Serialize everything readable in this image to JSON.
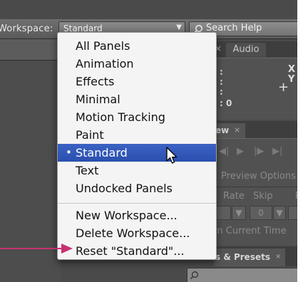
{
  "topbar": {
    "workspace_label": "Workspace:",
    "workspace_value": "Standard",
    "search_placeholder": "Search Help"
  },
  "menu": {
    "items": [
      {
        "label": "All Panels"
      },
      {
        "label": "Animation"
      },
      {
        "label": "Effects"
      },
      {
        "label": "Minimal"
      },
      {
        "label": "Motion Tracking"
      },
      {
        "label": "Paint"
      },
      {
        "label": "Standard",
        "selected": true
      },
      {
        "label": "Text"
      },
      {
        "label": "Undocked Panels"
      }
    ],
    "actions": [
      {
        "label": "New Workspace..."
      },
      {
        "label": "Delete Workspace..."
      },
      {
        "label": "Reset \"Standard\"..."
      }
    ],
    "selected_bullet": "•"
  },
  "info_panel": {
    "tab_audio": "Audio",
    "tab_close": "×",
    "value_a": "0",
    "x_label": "X",
    "y_label": "Y",
    "plus": "+"
  },
  "preview_panel": {
    "tab_label": "ew",
    "tab_close": "×",
    "options_label": "Preview Options",
    "rate_label": "Rate",
    "skip_label": "Skip",
    "r_label": "R",
    "skip_value": "0",
    "from_current_label": "m Current Time"
  },
  "effects_panel": {
    "tab_label": "s & Presets",
    "tab_close": "×"
  },
  "colors": {
    "menu_highlight": "#2f55b6",
    "callout_arrow": "#c8306f"
  }
}
